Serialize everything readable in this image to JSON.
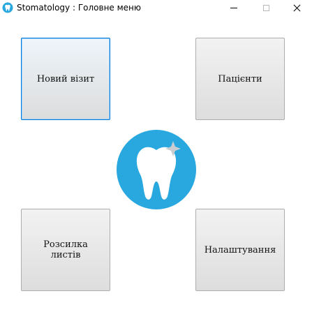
{
  "window": {
    "title": "Stomatology : Головне меню",
    "app_icon": "tooth-icon",
    "controls": [
      "minimize-icon",
      "maximize-icon",
      "close-icon"
    ]
  },
  "menu": {
    "new_visit": "Новий візит",
    "patients": "Пацієнти",
    "mailing": "Розсилка\nлистів",
    "settings": "Налаштування"
  },
  "logo": {
    "icon": "tooth-icon",
    "background_color": "#29a8e0",
    "foreground_color": "#ffffff"
  },
  "colors": {
    "focus_border": "#0078d7",
    "tile_border": "#adadad"
  }
}
